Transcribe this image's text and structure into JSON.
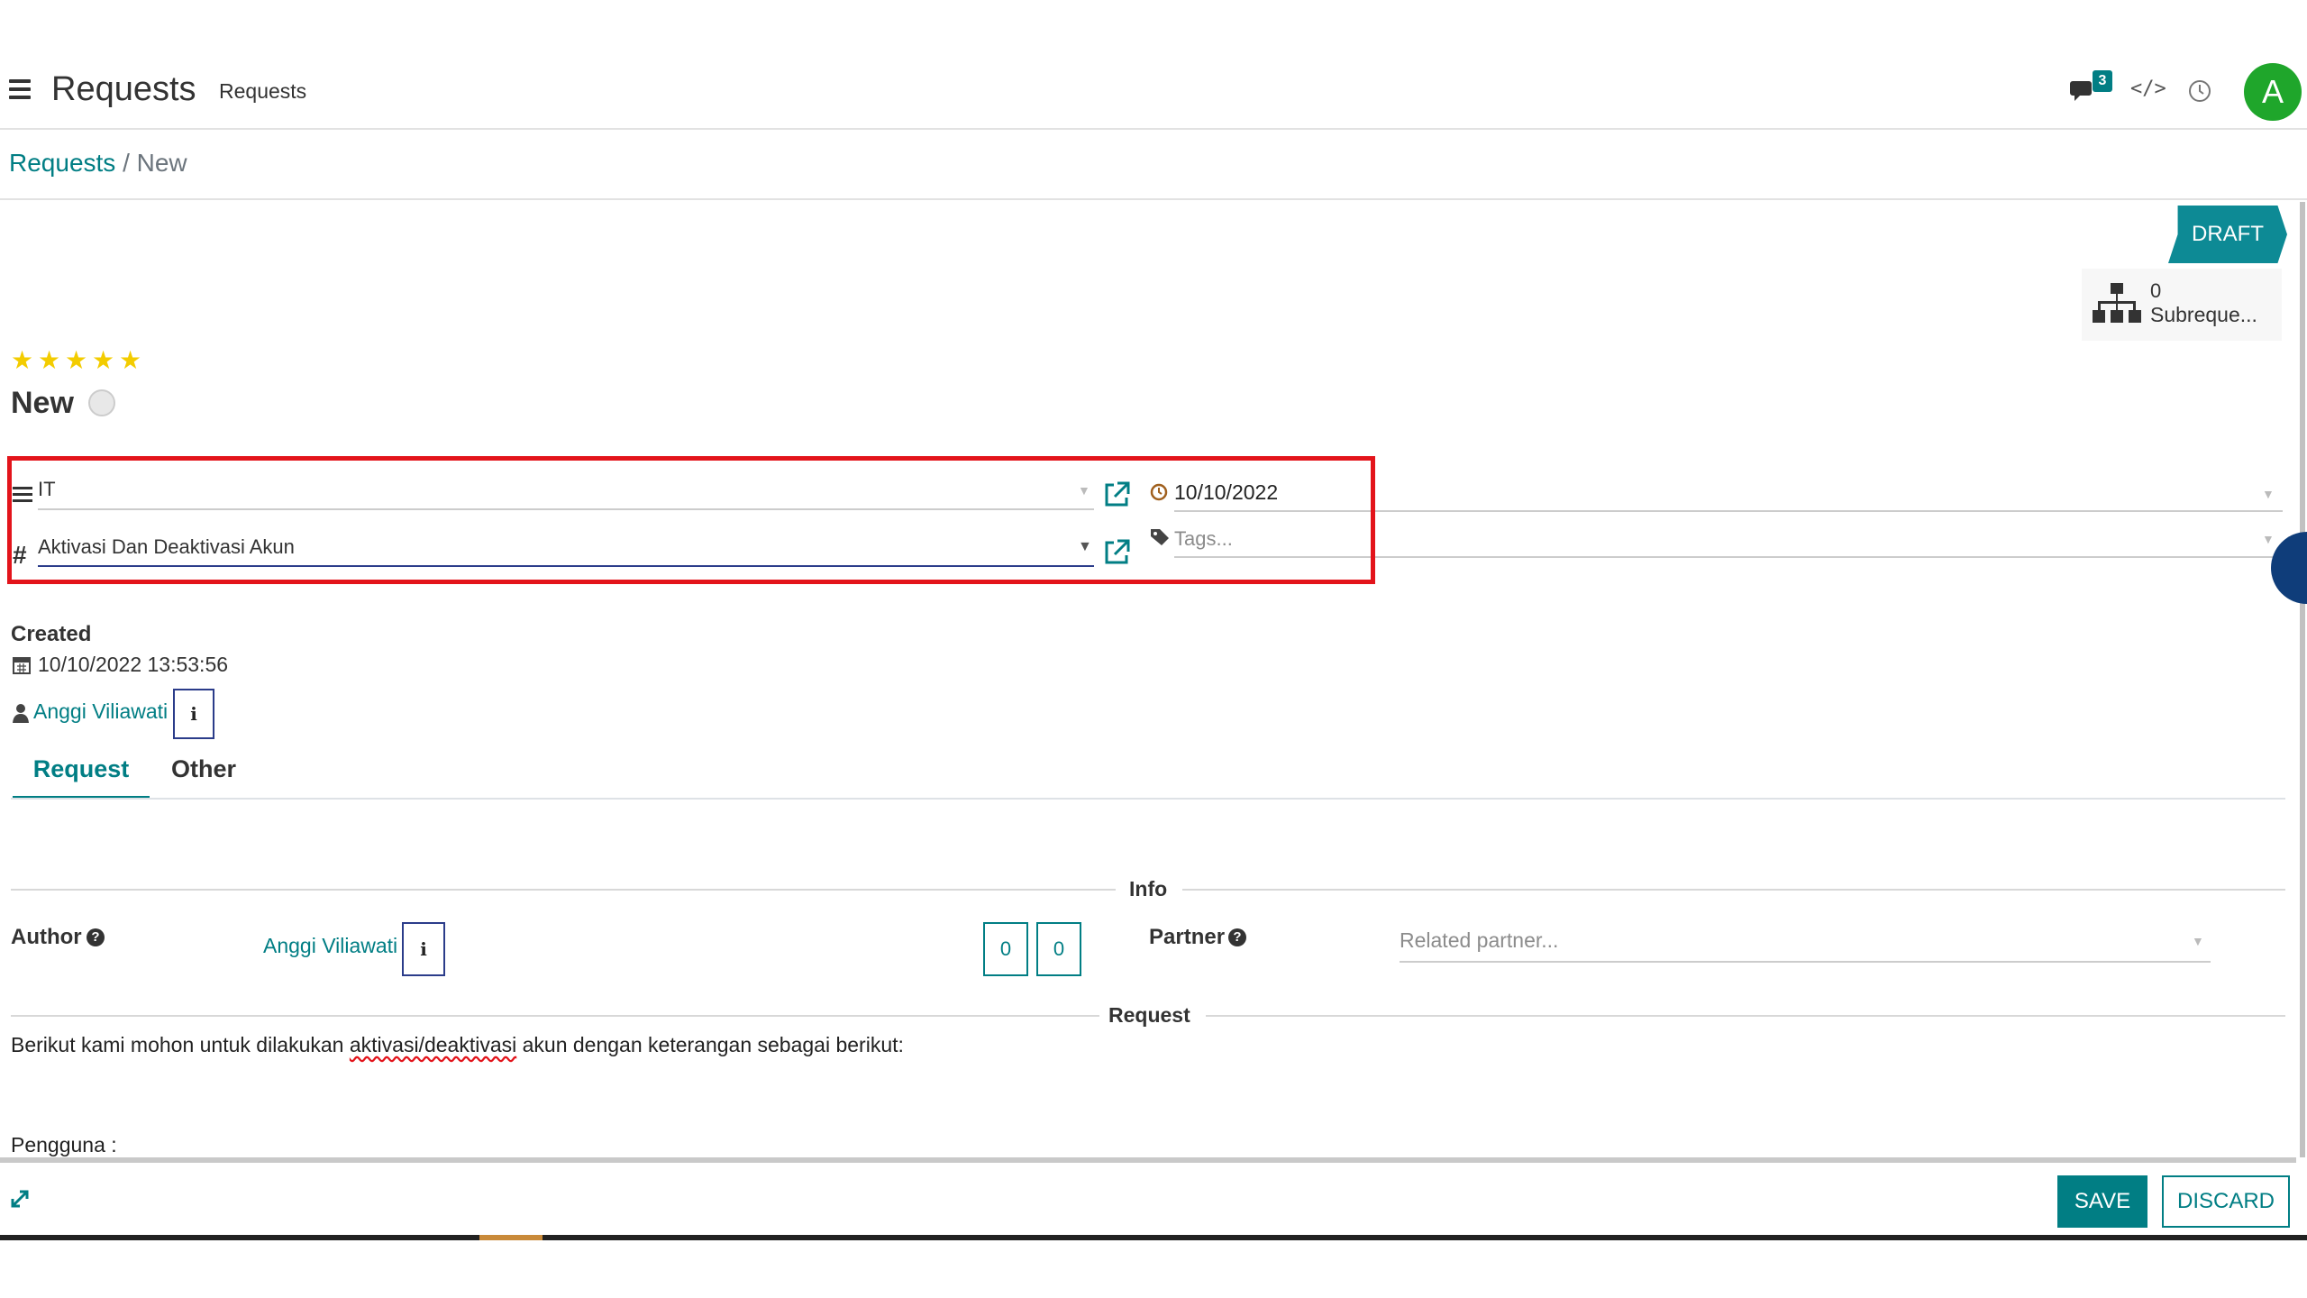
{
  "navbar": {
    "app_title": "Requests",
    "menu_item": "Requests",
    "chat_badge_count": "3",
    "code_icon": "</>",
    "avatar_letter": "A",
    "avatar_color": "#1fa62b"
  },
  "breadcrumb": {
    "parent": "Requests",
    "separator": "/",
    "current": "New"
  },
  "status": {
    "label": "DRAFT",
    "color": "#0d8a95"
  },
  "smart_button": {
    "count": "0",
    "label": "Subreque..."
  },
  "record": {
    "priority_stars": 5,
    "title": "New"
  },
  "fields": {
    "category": "IT",
    "request_type": "Aktivasi Dan Deaktivasi Akun",
    "deadline": "10/10/2022",
    "tags_placeholder": "Tags..."
  },
  "created": {
    "label": "Created",
    "date": "10/10/2022 13:53:56",
    "user": "Anggi Viliawati",
    "info_icon": "i"
  },
  "tabs": [
    {
      "label": "Request",
      "active": true
    },
    {
      "label": "Other",
      "active": false
    }
  ],
  "info_section": {
    "title": "Info",
    "author_label": "Author",
    "author_value": "Anggi Viliawati",
    "info_icon": "i",
    "counter_1": "0",
    "counter_2": "0",
    "partner_label": "Partner",
    "partner_placeholder": "Related partner...",
    "help_icon": "?"
  },
  "request_section": {
    "title": "Request",
    "body_prefix": "Berikut kami mohon untuk dilakukan ",
    "body_underlined": "aktivasi/deaktivasi",
    "body_suffix": " akun dengan keterangan sebagai berikut:",
    "pengguna_line": "Pengguna  :"
  },
  "actions": {
    "save": "SAVE",
    "discard": "DISCARD"
  },
  "colors": {
    "accent": "#017e84",
    "highlight_border": "#e3141b",
    "star": "#f3cc00"
  },
  "icons": [
    "hamburger-icon",
    "chat-icon",
    "code-icon",
    "clock-icon",
    "sitemap-icon",
    "lines-icon",
    "hash-icon",
    "external-link-icon",
    "clock-icon",
    "tag-icon",
    "calendar-icon",
    "user-icon",
    "help-icon",
    "expand-icon"
  ]
}
